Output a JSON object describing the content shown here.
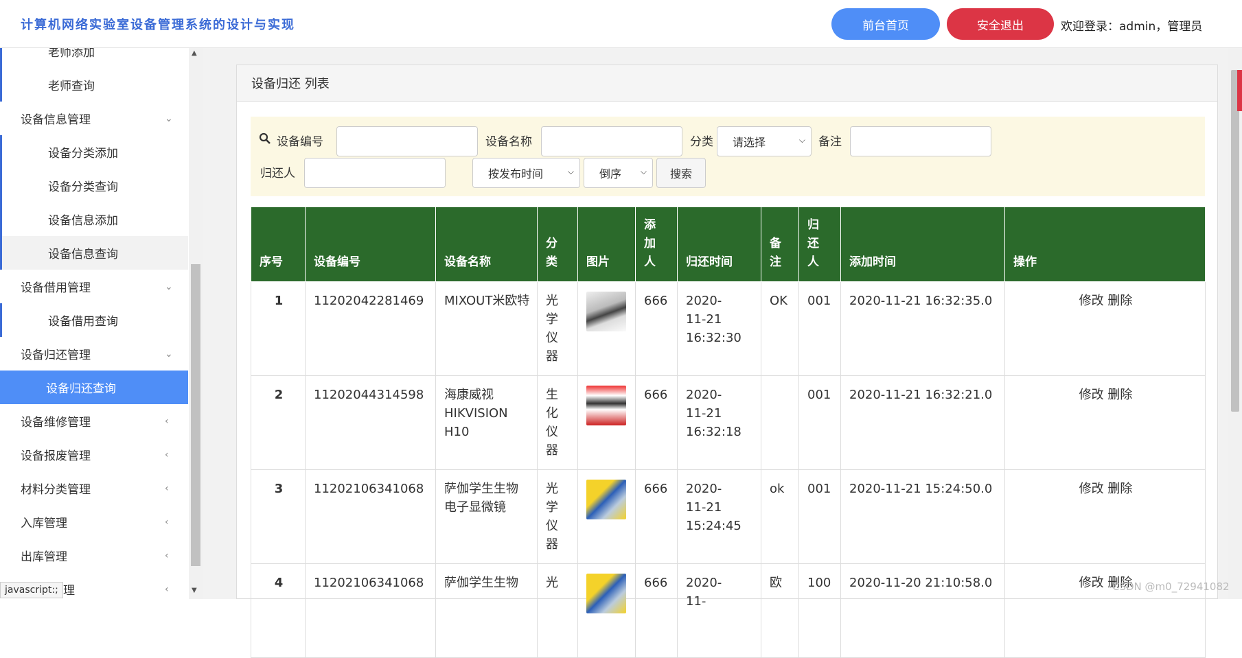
{
  "header": {
    "title": "计算机网络实验室设备管理系统的设计与实现",
    "home_btn": "前台首页",
    "logout_btn": "安全退出",
    "welcome": "欢迎登录：admin，管理员"
  },
  "sidebar": {
    "items": [
      {
        "label": "老师添加"
      },
      {
        "label": "老师查询"
      },
      {
        "label": "设备信息管理"
      },
      {
        "label": "设备分类添加"
      },
      {
        "label": "设备分类查询"
      },
      {
        "label": "设备信息添加"
      },
      {
        "label": "设备信息查询"
      },
      {
        "label": "设备借用管理"
      },
      {
        "label": "设备借用查询"
      },
      {
        "label": "设备归还管理"
      },
      {
        "label": "设备归还查询"
      },
      {
        "label": "设备维修管理"
      },
      {
        "label": "设备报废管理"
      },
      {
        "label": "材料分类管理"
      },
      {
        "label": "入库管理"
      },
      {
        "label": "出库管理"
      },
      {
        "label": "理"
      }
    ],
    "status_tip": "javascript:;"
  },
  "panel": {
    "title": "设备归还 列表"
  },
  "search": {
    "device_no_label": "设备编号",
    "device_name_label": "设备名称",
    "category_label": "分类",
    "category_value": "请选择",
    "remark_label": "备注",
    "returner_label": "归还人",
    "sort_field": "按发布时间",
    "sort_order": "倒序",
    "search_btn": "搜索"
  },
  "table": {
    "headers": [
      "序号",
      "设备编号",
      "设备名称",
      "分类",
      "图片",
      "添加人",
      "归还时间",
      "备注",
      "归还人",
      "添加时间",
      "操作"
    ],
    "rows": [
      {
        "no": "1",
        "code": "11202042281469",
        "name": "MIXOUT米欧特",
        "category": "光学仪器",
        "adder": "666",
        "return_time": "2020-11-21 16:32:30",
        "remark": "OK",
        "returner": "001",
        "created": "2020-11-21 16:32:35.0",
        "edit": "修改",
        "delete": "删除"
      },
      {
        "no": "2",
        "code": "11202044314598",
        "name": "海康威视HIKVISION H10",
        "category": "生化仪器",
        "adder": "666",
        "return_time": "2020-11-21 16:32:18",
        "remark": "",
        "returner": "001",
        "created": "2020-11-21 16:32:21.0",
        "edit": "修改",
        "delete": "删除"
      },
      {
        "no": "3",
        "code": "11202106341068",
        "name": "萨伽学生生物电子显微镜",
        "category": "光学仪器",
        "adder": "666",
        "return_time": "2020-11-21 15:24:45",
        "remark": "ok",
        "returner": "001",
        "created": "2020-11-21 15:24:50.0",
        "edit": "修改",
        "delete": "删除"
      },
      {
        "no": "4",
        "code": "11202106341068",
        "name": "萨伽学生生物",
        "category": "光",
        "adder": "666",
        "return_time": "2020-11-",
        "remark": "欧",
        "returner": "100",
        "created": "2020-11-20 21:10:58.0",
        "edit": "修改",
        "delete": "删除"
      }
    ]
  },
  "watermark": "CSDN @m0_72941082"
}
